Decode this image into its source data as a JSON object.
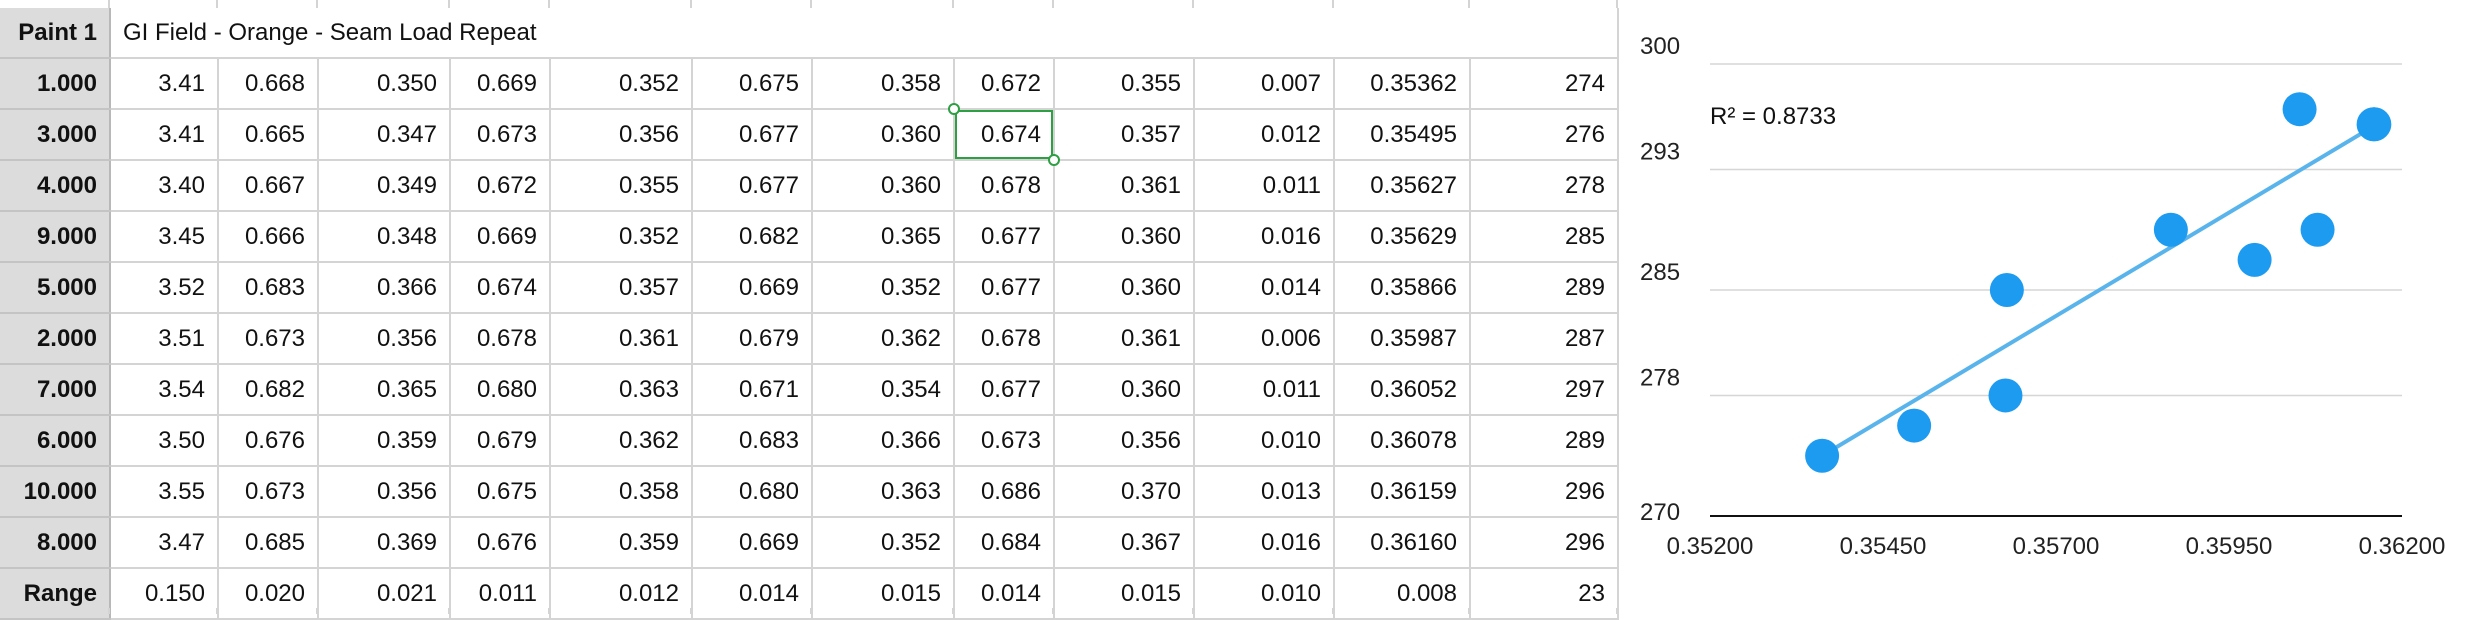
{
  "sheet": {
    "header_label": "Paint 1",
    "title": "GI Field - Orange - Seam Load Repeat",
    "rows": [
      {
        "label": "1.000",
        "cells": [
          "3.41",
          "0.668",
          "0.350",
          "0.669",
          "0.352",
          "0.675",
          "0.358",
          "0.672",
          "0.355",
          "0.007",
          "0.35362",
          "274"
        ]
      },
      {
        "label": "3.000",
        "cells": [
          "3.41",
          "0.665",
          "0.347",
          "0.673",
          "0.356",
          "0.677",
          "0.360",
          "0.674",
          "0.357",
          "0.012",
          "0.35495",
          "276"
        ]
      },
      {
        "label": "4.000",
        "cells": [
          "3.40",
          "0.667",
          "0.349",
          "0.672",
          "0.355",
          "0.677",
          "0.360",
          "0.678",
          "0.361",
          "0.011",
          "0.35627",
          "278"
        ]
      },
      {
        "label": "9.000",
        "cells": [
          "3.45",
          "0.666",
          "0.348",
          "0.669",
          "0.352",
          "0.682",
          "0.365",
          "0.677",
          "0.360",
          "0.016",
          "0.35629",
          "285"
        ]
      },
      {
        "label": "5.000",
        "cells": [
          "3.52",
          "0.683",
          "0.366",
          "0.674",
          "0.357",
          "0.669",
          "0.352",
          "0.677",
          "0.360",
          "0.014",
          "0.35866",
          "289"
        ]
      },
      {
        "label": "2.000",
        "cells": [
          "3.51",
          "0.673",
          "0.356",
          "0.678",
          "0.361",
          "0.679",
          "0.362",
          "0.678",
          "0.361",
          "0.006",
          "0.35987",
          "287"
        ]
      },
      {
        "label": "7.000",
        "cells": [
          "3.54",
          "0.682",
          "0.365",
          "0.680",
          "0.363",
          "0.671",
          "0.354",
          "0.677",
          "0.360",
          "0.011",
          "0.36052",
          "297"
        ]
      },
      {
        "label": "6.000",
        "cells": [
          "3.50",
          "0.676",
          "0.359",
          "0.679",
          "0.362",
          "0.683",
          "0.366",
          "0.673",
          "0.356",
          "0.010",
          "0.36078",
          "289"
        ]
      },
      {
        "label": "10.000",
        "cells": [
          "3.55",
          "0.673",
          "0.356",
          "0.675",
          "0.358",
          "0.680",
          "0.363",
          "0.686",
          "0.370",
          "0.013",
          "0.36159",
          "296"
        ]
      },
      {
        "label": "8.000",
        "cells": [
          "3.47",
          "0.685",
          "0.369",
          "0.676",
          "0.359",
          "0.669",
          "0.352",
          "0.684",
          "0.367",
          "0.016",
          "0.36160",
          "296"
        ]
      },
      {
        "label": "Range",
        "cells": [
          "0.150",
          "0.020",
          "0.021",
          "0.011",
          "0.012",
          "0.014",
          "0.015",
          "0.014",
          "0.015",
          "0.010",
          "0.008",
          "23"
        ]
      }
    ],
    "selected_cell": {
      "row": 1,
      "col": 7
    }
  },
  "chart_data": {
    "type": "scatter",
    "title": "",
    "xlabel": "",
    "ylabel": "",
    "x_ticks": [
      "0.35200",
      "0.35450",
      "0.35700",
      "0.35950",
      "0.36200"
    ],
    "y_ticks": [
      "270",
      "278",
      "285",
      "293",
      "300"
    ],
    "xlim": [
      0.352,
      0.362
    ],
    "ylim": [
      270,
      300
    ],
    "grid": true,
    "annotation": "R² = 0.8733",
    "marker_color": "#1d9bf0",
    "trendline_color": "#5ab4ec",
    "points": [
      {
        "x": 0.35362,
        "y": 274
      },
      {
        "x": 0.35495,
        "y": 276
      },
      {
        "x": 0.35627,
        "y": 278
      },
      {
        "x": 0.35629,
        "y": 285
      },
      {
        "x": 0.35866,
        "y": 289
      },
      {
        "x": 0.35987,
        "y": 287
      },
      {
        "x": 0.36052,
        "y": 297
      },
      {
        "x": 0.36078,
        "y": 289
      },
      {
        "x": 0.36159,
        "y": 296
      },
      {
        "x": 0.3616,
        "y": 296
      }
    ],
    "trendline": [
      {
        "x": 0.35362,
        "y": 274.0
      },
      {
        "x": 0.3616,
        "y": 295.9
      }
    ]
  }
}
